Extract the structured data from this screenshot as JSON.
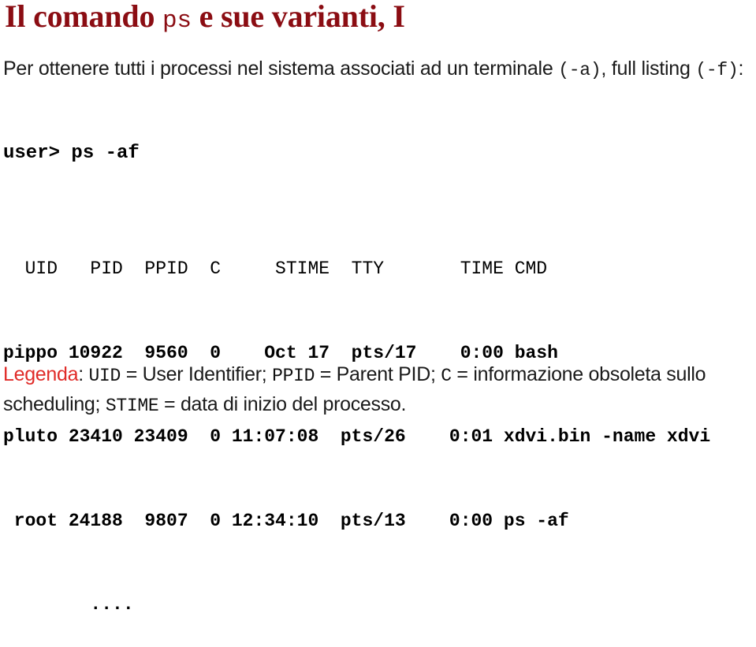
{
  "slide": {
    "title": {
      "before": "Il comando ",
      "mono": "ps",
      "after": " e sue varianti, I"
    },
    "intro": {
      "seg1": "Per ottenere tutti i processi nel sistema associati ad un terminale ",
      "opt_a": "(-a)",
      "seg2": ", full listing ",
      "opt_f": "(-f)",
      "seg3": ":"
    },
    "command": "user> ps -af",
    "ps_output": {
      "header": "  UID   PID  PPID  C     STIME  TTY       TIME CMD",
      "rows": [
        "pippo 10922  9560  0    Oct 17  pts/17    0:00 bash",
        "pluto 23410 23409  0 11:07:08  pts/26    0:01 xdvi.bin -name xdvi",
        " root 24188  9807  0 12:34:10  pts/13    0:00 ps -af"
      ],
      "ellipsis": "        ....",
      "columns": [
        "UID",
        "PID",
        "PPID",
        "C",
        "STIME",
        "TTY",
        "TIME",
        "CMD"
      ],
      "records": [
        {
          "UID": "pippo",
          "PID": "10922",
          "PPID": "9560",
          "C": "0",
          "STIME": "Oct 17",
          "TTY": "pts/17",
          "TIME": "0:00",
          "CMD": "bash"
        },
        {
          "UID": "pluto",
          "PID": "23410",
          "PPID": "23409",
          "C": "0",
          "STIME": "11:07:08",
          "TTY": "pts/26",
          "TIME": "0:01",
          "CMD": "xdvi.bin -name xdvi"
        },
        {
          "UID": "root",
          "PID": "24188",
          "PPID": "9807",
          "C": "0",
          "STIME": "12:34:10",
          "TTY": "pts/13",
          "TIME": "0:00",
          "CMD": "ps -af"
        }
      ]
    },
    "legend": {
      "keyword": "Legenda",
      "colon": ":  ",
      "uid": "UID",
      "eq1": " = ",
      "uid_expansion": "User Identifier;  ",
      "ppid": "PPID",
      "eq2": " = ",
      "ppid_expansion": "Parent PID;  ",
      "c": "C",
      "eq3": " = ",
      "c_expansion": "informazione obsoleta sullo scheduling;  ",
      "stime": "STIME",
      "eq4": " = ",
      "stime_expansion": "data di inizio del processo."
    }
  },
  "colors": {
    "title_red": "#8B0D13",
    "legend_red": "#E02B28",
    "body_text": "#1a1a1a",
    "mono_text": "#000000",
    "background": "#ffffff"
  }
}
